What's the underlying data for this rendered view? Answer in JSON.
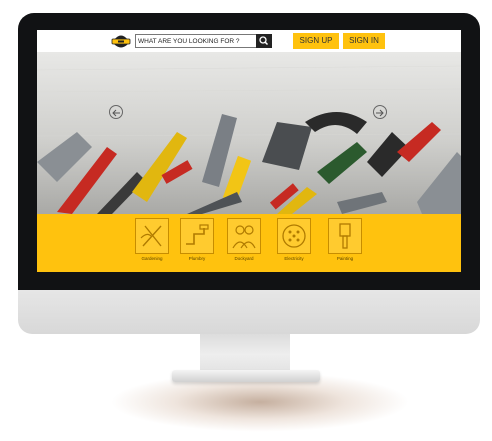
{
  "header": {
    "search_placeholder": "WHAT ARE YOU LOOKING FOR ?",
    "signup_label": "SIGN UP",
    "signin_label": "SIGN IN"
  },
  "hero": {
    "prev_icon": "arrow-left-icon",
    "next_icon": "arrow-right-icon"
  },
  "categories": [
    {
      "label": "Gardening",
      "icon": "gardening-icon"
    },
    {
      "label": "Plumbry",
      "icon": "plumbing-icon"
    },
    {
      "label": "Dockyard",
      "icon": "dockyard-icon"
    },
    {
      "label": "Electricity",
      "icon": "electricity-icon"
    },
    {
      "label": "Painting",
      "icon": "painting-icon"
    }
  ],
  "colors": {
    "accent": "#ffc20e",
    "bezel": "#111214",
    "search_button": "#222222"
  }
}
